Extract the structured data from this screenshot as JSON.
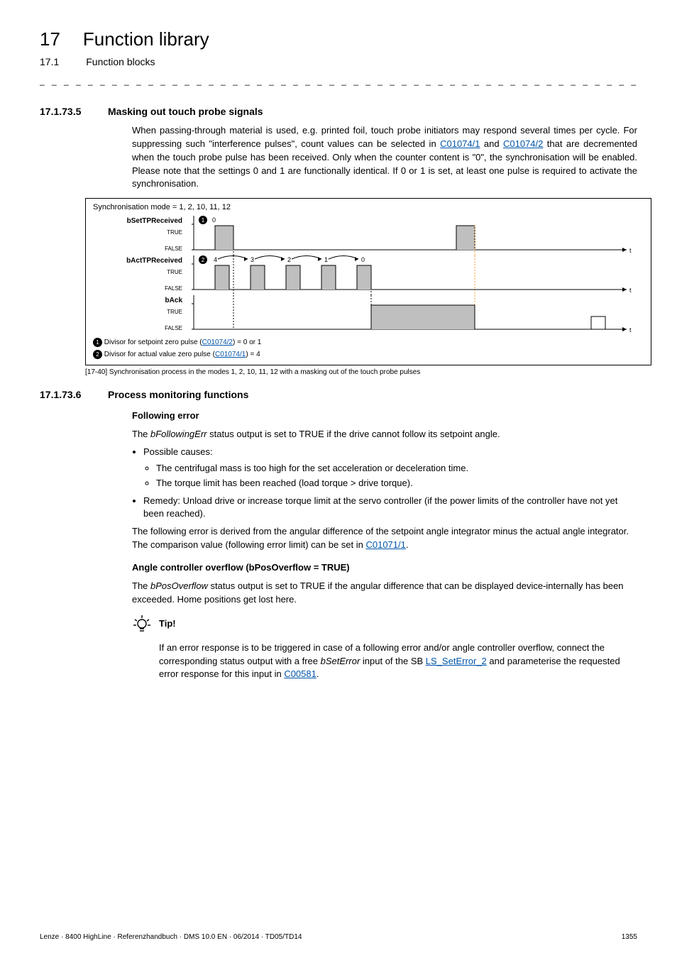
{
  "header": {
    "chapter_num": "17",
    "chapter_title": "Function library",
    "section_num": "17.1",
    "section_title": "Function blocks",
    "dashes": "_ _ _ _ _ _ _ _ _ _ _ _ _ _ _ _ _ _ _ _ _ _ _ _ _ _ _ _ _ _ _ _ _ _ _ _ _ _ _ _ _ _ _ _ _ _ _ _ _ _ _ _ _ _ _ _ _ _ _ _ _ _ _ _"
  },
  "h1": {
    "num": "17.1.73.5",
    "title": "Masking out touch probe signals"
  },
  "p1": {
    "t1": "When passing-through material is used, e.g. printed foil, touch probe initiators may respond several times per cycle. For suppressing such \"interference pulses\", count values can be selected in ",
    "l1": "C01074/1",
    "t2": " and ",
    "l2": "C01074/2",
    "t3": " that are decremented when the touch probe pulse has been received. Only when the counter content is \"0\", the synchronisation will be enabled. Please note that the settings 0 and 1 are functionally identical. If 0 or 1 is set, at least one pulse is required to activate the synchronisation."
  },
  "diagram": {
    "caption": "Synchronisation mode = 1, 2, 10, 11, 12",
    "row1": {
      "name": "bSetTPReceived",
      "true": "TRUE",
      "false": "FALSE",
      "circle": "1",
      "n0": "0"
    },
    "row2": {
      "name": "bActTPReceived",
      "true": "TRUE",
      "false": "FALSE",
      "circle": "2",
      "n4": "4",
      "n3": "3",
      "n2": "2",
      "n1": "1",
      "n0": "0"
    },
    "row3": {
      "name": "bAck",
      "true": "TRUE",
      "false": "FALSE"
    },
    "foot1a": " Divisor for setpoint zero pulse (",
    "foot1l": "C01074/2",
    "foot1b": ") = 0 or 1",
    "foot2a": " Divisor for actual value zero pulse (",
    "foot2l": "C01074/1",
    "foot2b": ") = 4"
  },
  "figcap": "[17-40]  Synchronisation process in the modes 1, 2, 10, 11, 12 with a masking out of the touch probe pulses",
  "h2": {
    "num": "17.1.73.6",
    "title": "Process monitoring functions"
  },
  "rh1": "Following error",
  "p2": {
    "t1": "The ",
    "i1": "bFollowingErr",
    "t2": " status output is set to TRUE if the drive cannot follow its setpoint angle."
  },
  "bul": {
    "a": "Possible causes:",
    "a1": "The centrifugal mass is too high for the set acceleration or deceleration time.",
    "a2": "The torque limit has been reached (load torque > drive torque).",
    "b": "Remedy: Unload drive or increase torque limit at the servo controller (if the power limits of the controller have not yet been reached)."
  },
  "p3": {
    "t1": "The following error is derived from the angular difference of the setpoint angle integrator minus the actual angle integrator. The comparison value (following error limit) can be set in ",
    "l1": "C01071/1",
    "t2": "."
  },
  "rh2": "Angle controller overflow (bPosOverflow = TRUE)",
  "p4": {
    "t1": "The ",
    "i1": "bPosOverflow",
    "t2": " status output is set to TRUE if the angular difference that can be displayed device-internally has been exceeded. Home positions get lost here."
  },
  "tip": {
    "label": "Tip!",
    "body1": "If an error response is to be triggered in case of a following error and/or angle controller overflow, connect the corresponding status output with a free ",
    "i1": "bSetError",
    "body2": " input of the SB ",
    "l1": "LS_SetError_2",
    "body3": " and parameterise the requested error response for this input in ",
    "l2": "C00581",
    "body4": "."
  },
  "footer": {
    "left": "Lenze · 8400 HighLine · Referenzhandbuch · DMS 10.0 EN · 06/2014 · TD05/TD14",
    "right": "1355"
  }
}
